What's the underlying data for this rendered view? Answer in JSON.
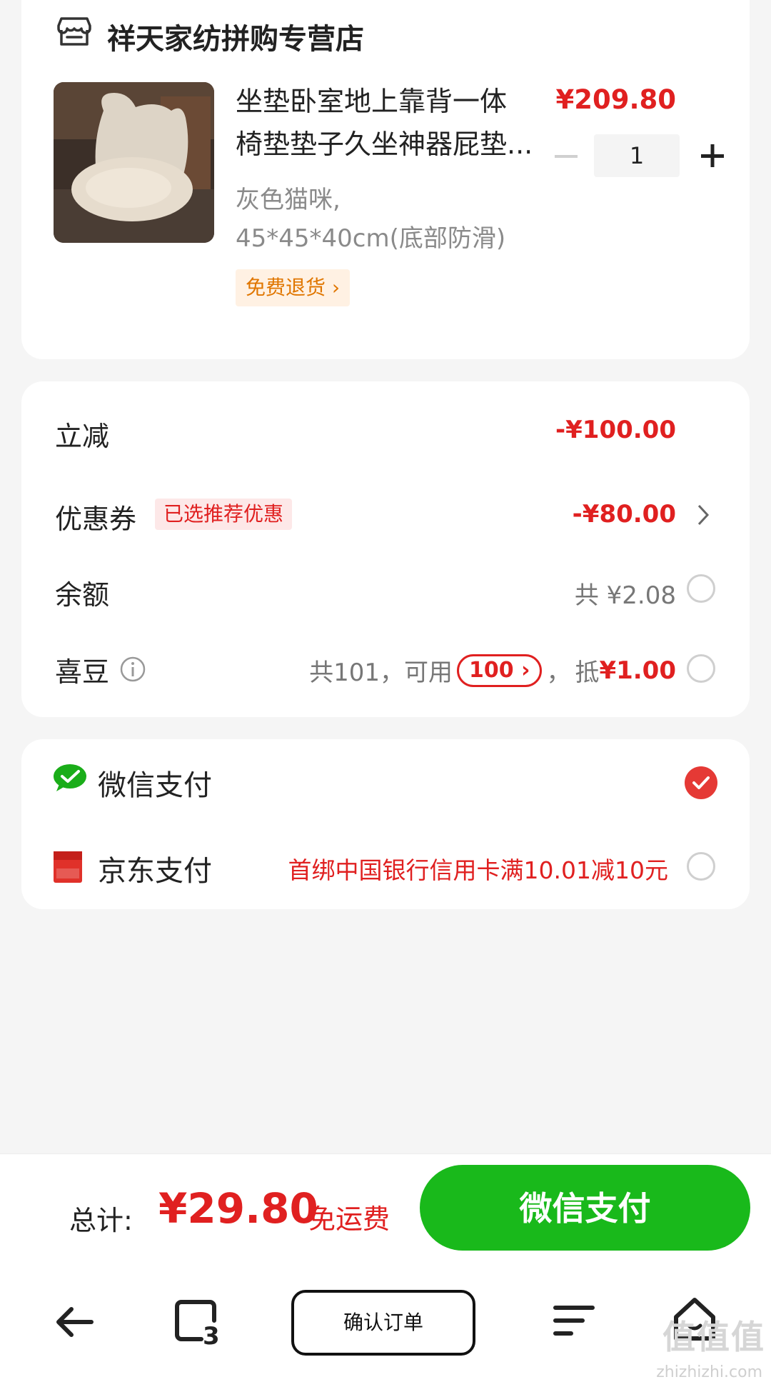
{
  "shop": {
    "name": "祥天家纺拼购专营店",
    "icon": "store-icon"
  },
  "product": {
    "title_line1": "坐垫卧室地上靠背一体",
    "title_line2": "椅垫垫子久坐神器屁垫...",
    "spec_line1": "灰色猫咪,",
    "spec_line2": "45*45*40cm(底部防滑)",
    "return_tag": "免费退货 ›",
    "price": "¥209.80",
    "quantity": "1"
  },
  "discounts": {
    "instant": {
      "label": "立减",
      "value": "-¥100.00"
    },
    "coupon": {
      "label": "优惠券",
      "tag": "已选推荐优惠",
      "value": "-¥80.00"
    },
    "balance": {
      "label": "余额",
      "value": "共 ¥2.08",
      "selected": false
    },
    "beans": {
      "label": "喜豆",
      "total_text": "共101，可用",
      "usable": "100 ›",
      "comma": "，",
      "deduct_label": "抵",
      "deduct_value": "¥1.00",
      "selected": false
    }
  },
  "payment": {
    "wechat": {
      "label": "微信支付",
      "selected": true,
      "icon": "wechat-pay-icon"
    },
    "jd": {
      "label": "京东支付",
      "promo": "首绑中国银行信用卡满10.01减10元",
      "selected": false,
      "icon": "jd-pay-icon"
    }
  },
  "footer": {
    "total_label": "总计:",
    "total_value": "¥29.80",
    "shipping": "免运费",
    "pay_button": "微信支付"
  },
  "nav": {
    "tab_count": "3",
    "confirm_order": "确认订单"
  },
  "watermark": {
    "text": "值值值",
    "url": "zhizhizhi.com"
  },
  "colors": {
    "accent_red": "#e02020",
    "wechat_green": "#19b91b",
    "checked_red": "#e53935"
  }
}
